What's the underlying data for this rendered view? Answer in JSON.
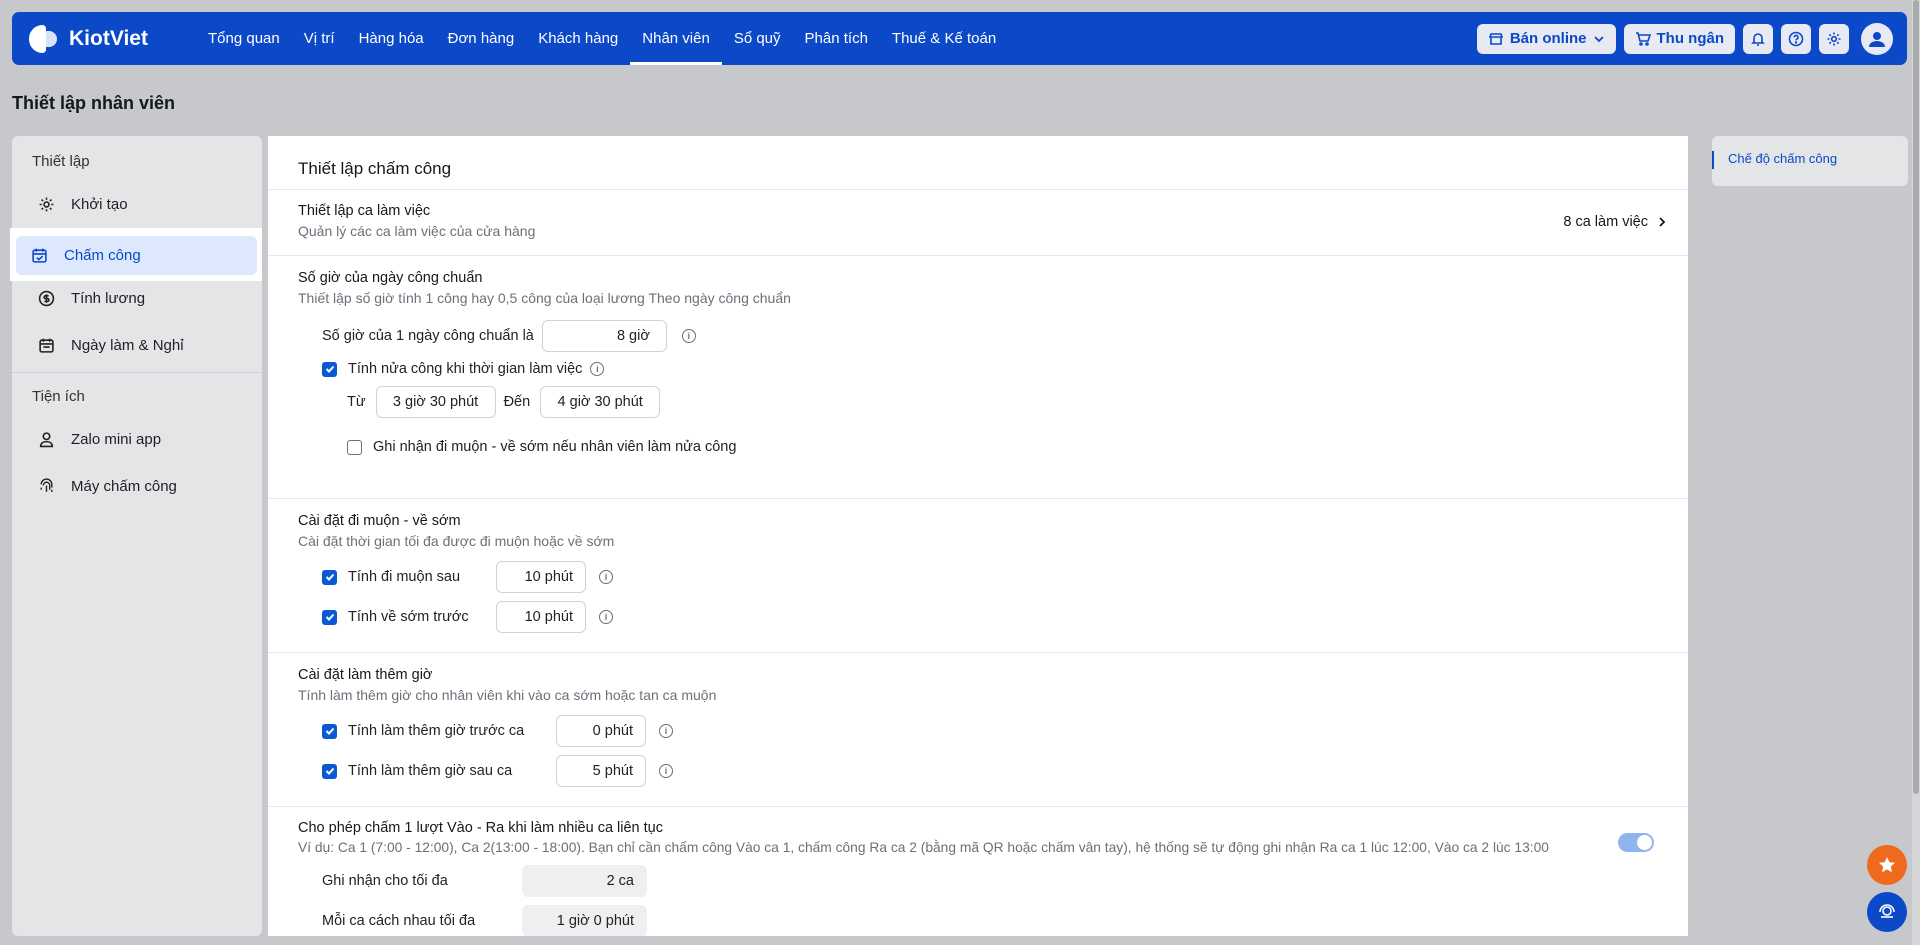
{
  "brand": {
    "name": "KiotViet"
  },
  "nav": {
    "items": [
      "Tổng quan",
      "Vị trí",
      "Hàng hóa",
      "Đơn hàng",
      "Khách hàng",
      "Nhân viên",
      "Sổ quỹ",
      "Phân tích",
      "Thuế & Kế toán"
    ],
    "active": "Nhân viên"
  },
  "topright": {
    "online_label": "Bán online",
    "cashier_label": "Thu ngân"
  },
  "page": {
    "title": "Thiết lập nhân viên"
  },
  "sidebar": {
    "group1": "Thiết lập",
    "items": [
      "Khởi tạo",
      "Chấm công",
      "Tính lương",
      "Ngày làm & Nghỉ"
    ],
    "group2": "Tiện ích",
    "items2": [
      "Zalo mini app",
      "Máy chấm công"
    ]
  },
  "main": {
    "title": "Thiết lập chấm công",
    "shift": {
      "title": "Thiết lập ca làm việc",
      "desc": "Quản lý các ca làm việc của cửa hàng",
      "count": "8 ca làm việc"
    },
    "standard": {
      "title": "Số giờ của ngày công chuẩn",
      "desc": "Thiết lập số giờ tính 1 công hay 0,5 công của loại lương Theo ngày công chuẩn",
      "hours_label": "Số giờ của 1 ngày công chuẩn là",
      "hours_value": "8 giờ",
      "half_label": "Tính nửa công khi thời gian làm việc",
      "from_label": "Từ",
      "from_value": "3 giờ 30 phút",
      "to_label": "Đến",
      "to_value": "4 giờ 30 phút",
      "record_label": "Ghi nhận đi muộn - về sớm nếu nhân viên làm nửa công"
    },
    "late": {
      "title": "Cài đặt đi muộn - về sớm",
      "desc": "Cài đặt thời gian tối đa được đi muộn hoặc về sớm",
      "late_label": "Tính đi muộn sau",
      "late_value": "10 phút",
      "early_label": "Tính về sớm trước",
      "early_value": "10 phút"
    },
    "overtime": {
      "title": "Cài đặt làm thêm giờ",
      "desc": "Tính làm thêm giờ cho nhân viên khi vào ca sớm hoặc tan ca muộn",
      "before_label": "Tính làm thêm giờ trước ca",
      "before_value": "0 phút",
      "after_label": "Tính làm thêm giờ sau ca",
      "after_value": "5 phút"
    },
    "multi": {
      "title": "Cho phép chấm 1 lượt Vào - Ra khi làm nhiều ca liên tục",
      "desc": "Ví dụ: Ca 1 (7:00 - 12:00), Ca 2(13:00 - 18:00). Bạn chỉ cần chấm công Vào ca 1, chấm công Ra ca 2 (bằng mã QR hoặc chấm vân tay), hệ thống sẽ tự động ghi nhận Ra ca 1 lúc 12:00, Vào ca 2 lúc 13:00",
      "max_label": "Ghi nhận cho tối đa",
      "max_value": "2 ca",
      "gap_label": "Mỗi ca cách nhau tối đa",
      "gap_value": "1 giờ 0 phút"
    }
  },
  "right": {
    "link": "Chế độ chấm công"
  },
  "colors": {
    "brand": "#0b49c8",
    "accent": "#0b58d6",
    "fab_star": "#f06a1d"
  }
}
